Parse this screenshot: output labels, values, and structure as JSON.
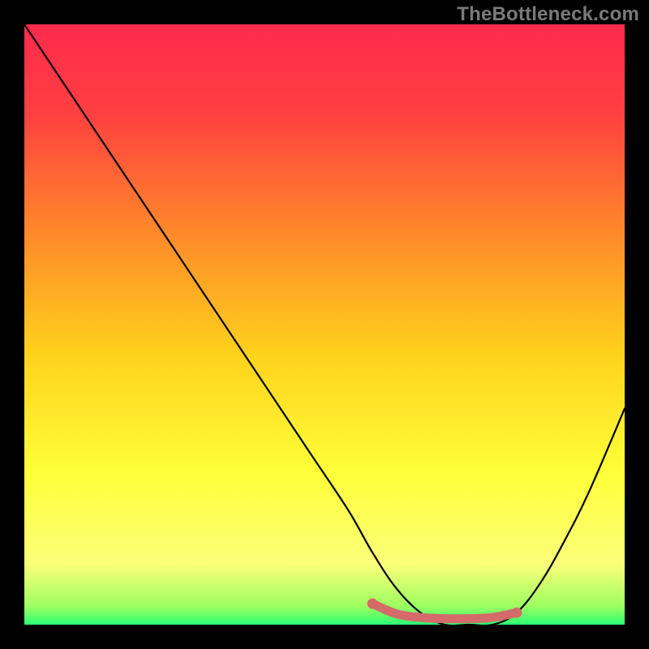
{
  "watermark": "TheBottleneck.com",
  "chart_data": {
    "type": "line",
    "title": "",
    "xlabel": "",
    "ylabel": "",
    "xlim": [
      0,
      100
    ],
    "ylim": [
      0,
      100
    ],
    "grid": false,
    "legend": false,
    "gradient_stops": [
      {
        "offset": 0,
        "color": "#ff2a4e"
      },
      {
        "offset": 15,
        "color": "#ff4040"
      },
      {
        "offset": 35,
        "color": "#ff8a2a"
      },
      {
        "offset": 55,
        "color": "#ffd21c"
      },
      {
        "offset": 75,
        "color": "#ffff3a"
      },
      {
        "offset": 90,
        "color": "#fbff7a"
      },
      {
        "offset": 97,
        "color": "#9cff60"
      },
      {
        "offset": 100,
        "color": "#2bff74"
      }
    ],
    "series": [
      {
        "name": "bottleneck-curve",
        "color": "#000000",
        "x": [
          0,
          6,
          12,
          18,
          24,
          30,
          36,
          42,
          48,
          54,
          58,
          62,
          66,
          70,
          74,
          78,
          82,
          86,
          90,
          94,
          100
        ],
        "y": [
          100,
          91,
          82,
          73,
          64,
          55,
          46,
          37,
          28,
          19,
          12,
          6,
          2,
          0,
          0,
          0,
          2,
          7,
          14,
          22,
          36
        ]
      },
      {
        "name": "sweet-spot",
        "color": "#d46a6a",
        "thick": true,
        "x": [
          58,
          62,
          66,
          70,
          74,
          78,
          82
        ],
        "y": [
          3.5,
          1.8,
          1.2,
          1.0,
          1.0,
          1.2,
          2.0
        ]
      }
    ]
  }
}
